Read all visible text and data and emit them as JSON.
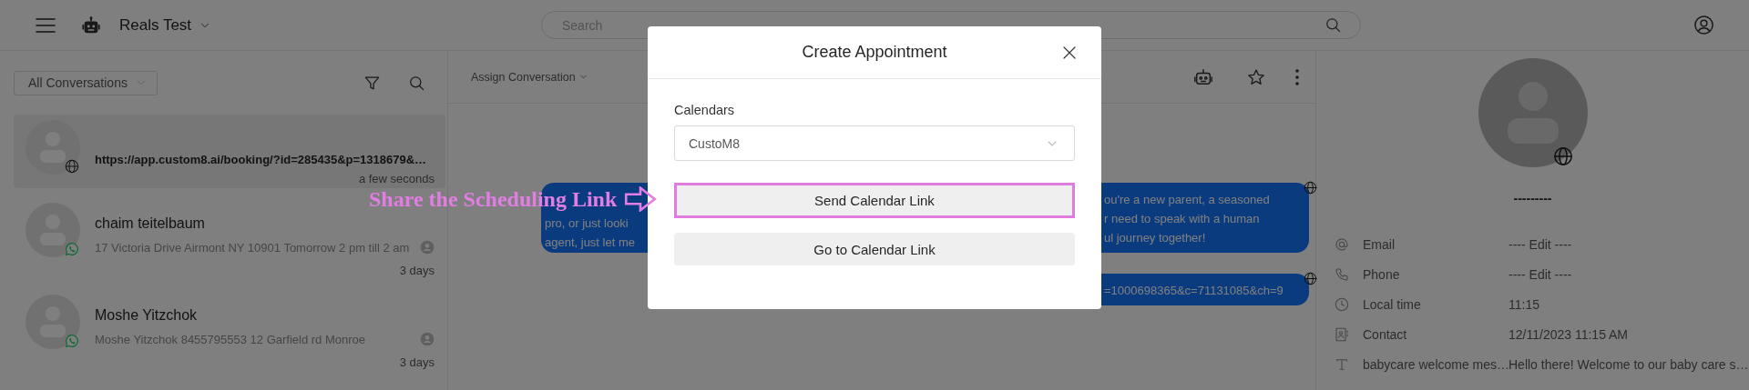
{
  "topbar": {
    "workspace": "Reals Test",
    "search": {
      "placeholder": "Search"
    }
  },
  "conversations": {
    "filter": "All Conversations",
    "items": [
      {
        "preview": "https://app.custom8.ai/booking/?id=285435&p=1318679&…",
        "time": "a few seconds",
        "kind": "web",
        "selected": true,
        "unread": true,
        "assigned": false
      },
      {
        "name": "chaim teitelbaum",
        "preview": "17 Victoria Drive Airmont NY 10901 Tomorrow 2 pm till 2 am",
        "time": "3 days",
        "kind": "whatsapp",
        "selected": false,
        "unread": false,
        "assigned": true
      },
      {
        "name": "Moshe Yitzchok",
        "preview": "Moshe Yitzchok 8455795553 12 Garfield rd Monroe",
        "time": "3 days",
        "kind": "whatsapp",
        "selected": false,
        "unread": false,
        "assigned": true
      }
    ]
  },
  "chat": {
    "assign_label": "Assign Conversation",
    "messages": [
      {
        "left_lines": [
          "pro, or just looki",
          "agent, just let me"
        ],
        "right_lines": [
          "ou're a new parent, a seasoned",
          "r need to speak with a human",
          "ul journey together!"
        ]
      },
      {
        "right_lines": [
          "=1000698365&c=71131085&ch=9"
        ]
      }
    ]
  },
  "contact": {
    "name": "---------",
    "fields": [
      {
        "kind": "email",
        "label": "Email",
        "value": "---- Edit ----"
      },
      {
        "kind": "phone",
        "label": "Phone",
        "value": "---- Edit ----"
      },
      {
        "kind": "time",
        "label": "Local time",
        "value": "11:15"
      },
      {
        "kind": "contact",
        "label": "Contact",
        "value": "12/11/2023 11:15 AM"
      },
      {
        "kind": "text",
        "label": "babycare welcome mes…",
        "value": "Hello there! Welcome to our baby care s…"
      }
    ]
  },
  "modal": {
    "title": "Create Appointment",
    "calendar_label": "Calendars",
    "calendar_value": "CustoM8",
    "buttons": [
      {
        "label": "Send Calendar Link",
        "highlighted": true
      },
      {
        "label": "Go to Calendar Link",
        "highlighted": false
      }
    ]
  },
  "annotation": {
    "text": "Share the Scheduling Link"
  }
}
